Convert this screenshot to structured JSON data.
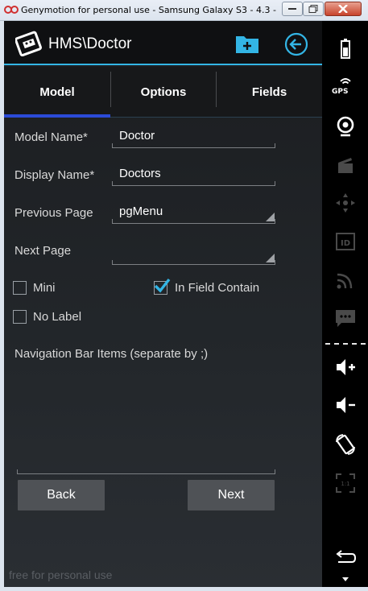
{
  "window": {
    "title": "Genymotion for personal use - Samsung Galaxy S3 - 4.3 -"
  },
  "app": {
    "title": "HMS\\Doctor",
    "accent_color": "#33b5e5"
  },
  "tabs": [
    {
      "label": "Model",
      "selected": true
    },
    {
      "label": "Options",
      "selected": false
    },
    {
      "label": "Fields",
      "selected": false
    }
  ],
  "form": {
    "model_name": {
      "label": "Model Name*",
      "value": "Doctor"
    },
    "display_name": {
      "label": "Display Name*",
      "value": "Doctors"
    },
    "previous_page": {
      "label": "Previous Page",
      "value": "pgMenu"
    },
    "next_page": {
      "label": "Next Page",
      "value": ""
    },
    "mini": {
      "label": "Mini",
      "checked": false
    },
    "in_field_contain": {
      "label": "In Field Contain",
      "checked": true
    },
    "no_label": {
      "label": "No Label",
      "checked": false
    },
    "nav_bar_items": {
      "label": "Navigation Bar Items (separate by ;)",
      "value": ""
    }
  },
  "buttons": {
    "back": "Back",
    "next": "Next"
  },
  "watermark": "free for personal use",
  "sidebar": {
    "gps_label": "GPS",
    "icons": [
      "battery-icon",
      "gps-icon",
      "webcam-icon",
      "clapper-icon",
      "dpad-icon",
      "id-icon",
      "rss-icon",
      "sms-icon",
      "volume-up-icon",
      "volume-down-icon",
      "rotate-icon",
      "scale-icon",
      "android-back-icon",
      "menu-arrow-icon"
    ]
  }
}
